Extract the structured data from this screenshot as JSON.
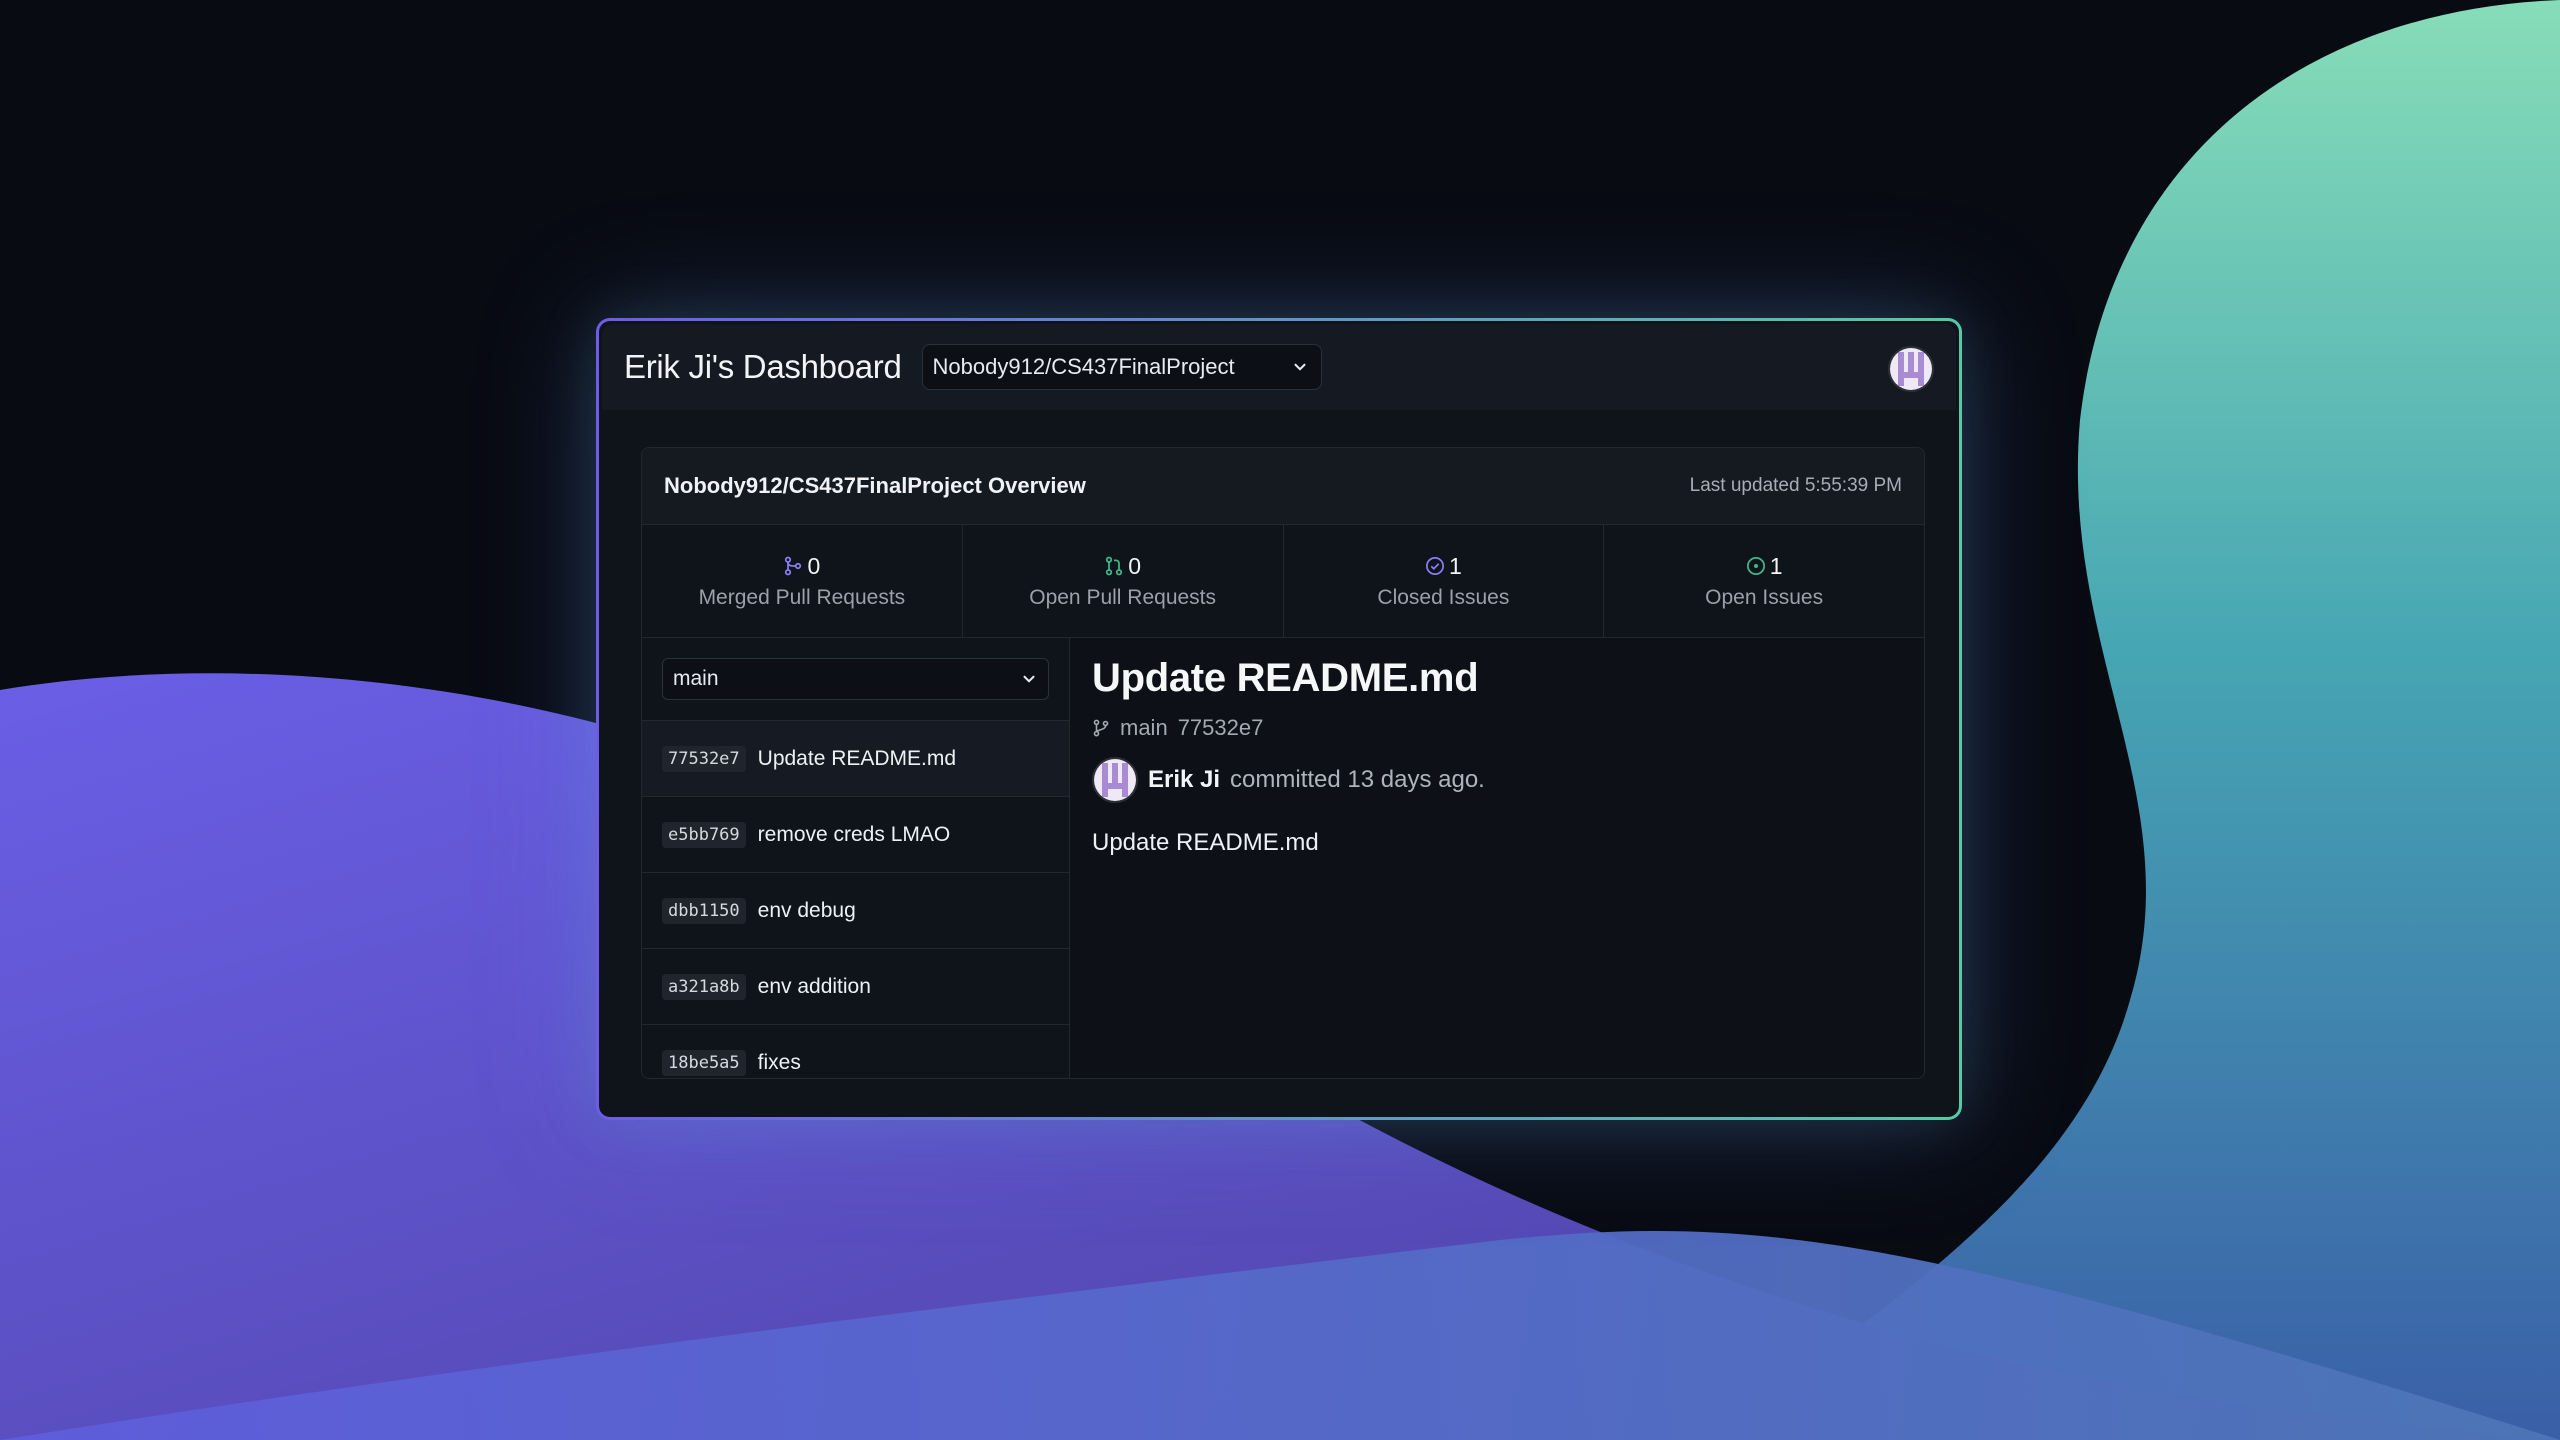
{
  "header": {
    "title": "Erik Ji's Dashboard",
    "repo_selected": "Nobody912/CS437FinalProject"
  },
  "overview": {
    "title": "Nobody912/CS437FinalProject Overview",
    "last_updated": "Last updated 5:55:39 PM",
    "stats": [
      {
        "value": "0",
        "label": "Merged Pull Requests",
        "icon": "merge-icon"
      },
      {
        "value": "0",
        "label": "Open Pull Requests",
        "icon": "pull-request-icon"
      },
      {
        "value": "1",
        "label": "Closed Issues",
        "icon": "issue-closed-icon"
      },
      {
        "value": "1",
        "label": "Open Issues",
        "icon": "issue-open-icon"
      }
    ]
  },
  "branch": {
    "selected": "main"
  },
  "commits": [
    {
      "sha": "77532e7",
      "message": "Update README.md"
    },
    {
      "sha": "e5bb769",
      "message": "remove creds LMAO"
    },
    {
      "sha": "dbb1150",
      "message": "env debug"
    },
    {
      "sha": "a321a8b",
      "message": "env addition"
    },
    {
      "sha": "18be5a5",
      "message": "fixes"
    }
  ],
  "detail": {
    "title": "Update README.md",
    "branch": "main",
    "sha": "77532e7",
    "author": "Erik Ji",
    "committed_text": "committed 13 days ago.",
    "body": "Update README.md"
  },
  "colors": {
    "merge": "#8b7cf6",
    "pull_request": "#3fb889",
    "issue_closed": "#8b7cf6",
    "issue_open": "#3fb889"
  }
}
